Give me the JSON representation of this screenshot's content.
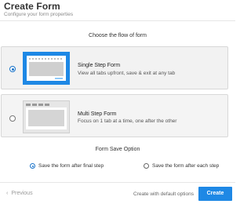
{
  "header": {
    "title": "Create Form",
    "subtitle": "Configure your form properties"
  },
  "flow": {
    "heading": "Choose the flow of form",
    "options": [
      {
        "title": "Single Step Form",
        "description": "View all tabs upfront, save & exit at any tab",
        "selected": true
      },
      {
        "title": "Multi Step Form",
        "description": "Focus on 1 tab at a time, one after the other",
        "selected": false
      }
    ]
  },
  "save": {
    "heading": "Form Save Option",
    "options": [
      {
        "label": "Save the form after final step",
        "selected": true
      },
      {
        "label": "Save the form after each step",
        "selected": false
      }
    ]
  },
  "footer": {
    "previous_label": "Previous",
    "default_label": "Create with default options",
    "create_label": "Create"
  },
  "colors": {
    "accent": "#1e88e5",
    "card_bg": "#f2f2f2"
  }
}
